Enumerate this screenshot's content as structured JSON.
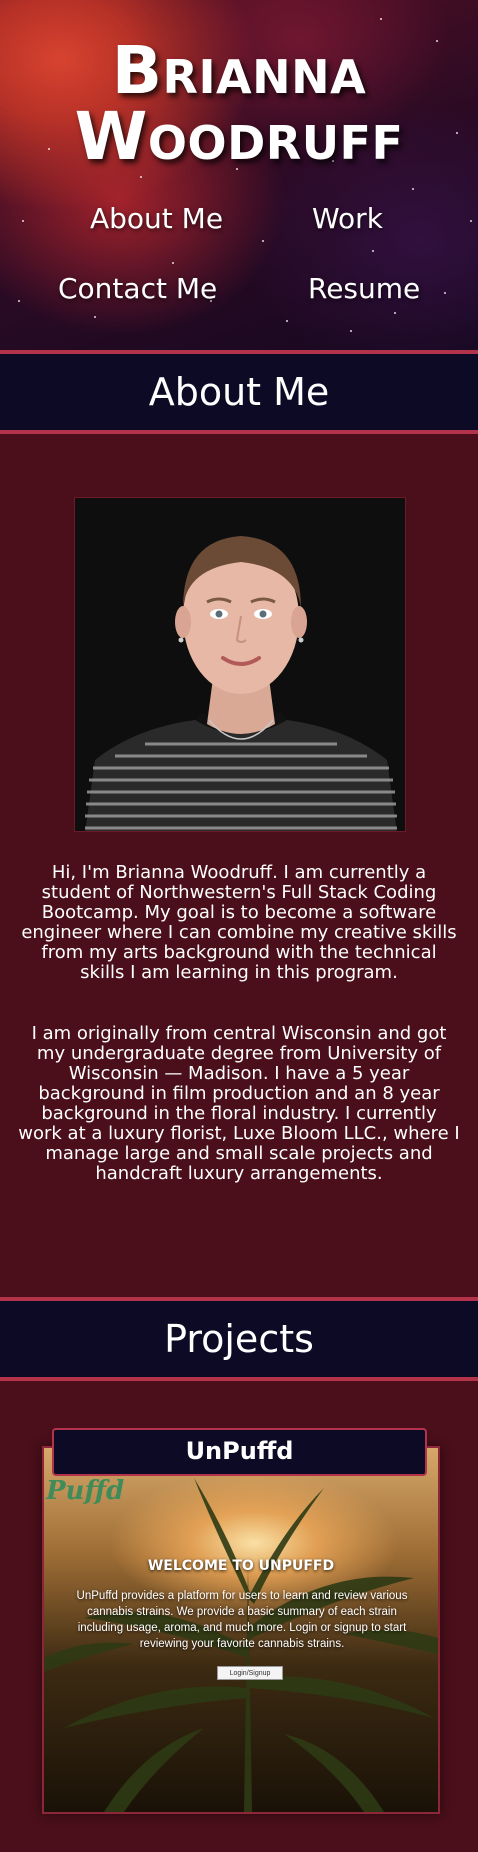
{
  "header": {
    "title_line1": "Brianna",
    "title_line2": "Woodruff",
    "nav": [
      {
        "label": "About Me"
      },
      {
        "label": "Work"
      },
      {
        "label": "Contact Me"
      },
      {
        "label": "Resume"
      }
    ]
  },
  "about": {
    "heading": "About Me",
    "photo_icon": "profile-photo",
    "paragraphs": [
      "Hi, I'm Brianna Woodruff. I am currently a student of Northwestern's Full Stack Coding Bootcamp. My goal is to become a software engineer where I can combine my creative skills from my arts background with the technical skills I am learning in this program.",
      "I am originally from central Wisconsin and got my undergraduate degree from University of Wisconsin — Madison. I have a 5 year background in film production and an 8 year background in the floral industry. I currently work at a luxury florist, Luxe Bloom LLC., where I manage large and small scale projects and handcraft luxury arrangements."
    ]
  },
  "projects": {
    "heading": "Projects",
    "items": [
      {
        "title": "UnPuffd",
        "screenshot": {
          "logo": "Puffd",
          "welcome": "WELCOME TO UNPUFFD",
          "description": "UnPuffd provides a platform for users to learn and review various cannabis strains. We provide a basic summary of each strain including usage, aroma, and much more. Login or signup to start reviewing your favorite cannabis strains.",
          "button": "Login/Signup"
        }
      }
    ]
  },
  "colors": {
    "page_bg": "#4a0f1a",
    "banner_bg": "#0c0a24",
    "accent_border": "#b2334a"
  }
}
